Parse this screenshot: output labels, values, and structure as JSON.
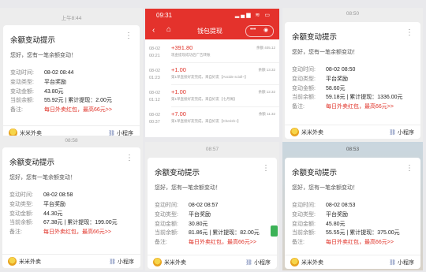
{
  "common": {
    "title": "余额变动提示",
    "greeting": "您好，您有一笔余额变动！",
    "labels": [
      "变动时间:",
      "变动类型:",
      "变动金额:",
      "当前余额:",
      "备注:"
    ],
    "app_name": "米米外卖",
    "mini_program": "小程序",
    "menu_glyph": "⋮",
    "link_icon": "link-icon",
    "logo_icon": "mimi-logo-icon"
  },
  "cards": [
    {
      "timestamp": "上午8:44",
      "time": "08-02 08:44",
      "type": "平台奖励",
      "amount": "43.80元",
      "balance": "55.92元 | 累计提现：2.00元",
      "note": "每日外卖红包，最高66元>>"
    },
    {
      "timestamp": "08:50",
      "time": "08-02 08:50",
      "type": "平台奖励",
      "amount": "58.60元",
      "balance": "59.18元 | 累计提现：1336.00元",
      "note": "每日外卖红包，最高66元>>"
    },
    {
      "timestamp": "08:58",
      "time": "08-02 08:58",
      "type": "平台奖励",
      "amount": "44.30元",
      "balance": "67.38元 | 累计提现：199.00元",
      "note": "每日外卖红包，最高66元>>"
    },
    {
      "timestamp": "08:57",
      "time": "08-02 08:57",
      "type": "平台奖励",
      "amount": "30.80元",
      "balance": "81.86元 | 累计提现：82.00元",
      "note": "每日外卖红包，最高66元>>"
    },
    {
      "timestamp": "08:53",
      "time": "08-02 08:53",
      "type": "平台奖励",
      "amount": "45.80元",
      "balance": "55.55元 | 累计提现：375.00元",
      "note": "每日外卖红包，最高66元>>"
    }
  ],
  "wallet": {
    "status_time": "09:31",
    "status_icons": "▂▄▆ ≋ ▭",
    "title": "钱包提现",
    "back_icon": "‹",
    "home_icon": "⌂",
    "pill_more": "•••",
    "pill_close": "◉",
    "entries": [
      {
        "date": "08-02",
        "clock": "00:21",
        "amount": "+391.80",
        "desc": "现金提现成功后广告转账",
        "balance": "余额 405.12"
      },
      {
        "date": "08-02",
        "clock": "01:23",
        "amount": "+1.00",
        "desc": "第1单直接好友完成，来自好友【Ascide scioll~】",
        "balance": "余额 13.32"
      },
      {
        "date": "08-02",
        "clock": "01:12",
        "amount": "+1.00",
        "desc": "第1单直接好友完成，来自好友【七月阁】",
        "balance": "余额 12.32"
      },
      {
        "date": "08-02",
        "clock": "00:37",
        "amount": "+7.00",
        "desc": "第1单直接好友完成，来自好友【Cherish~】",
        "balance": "余额 11.32"
      }
    ]
  }
}
